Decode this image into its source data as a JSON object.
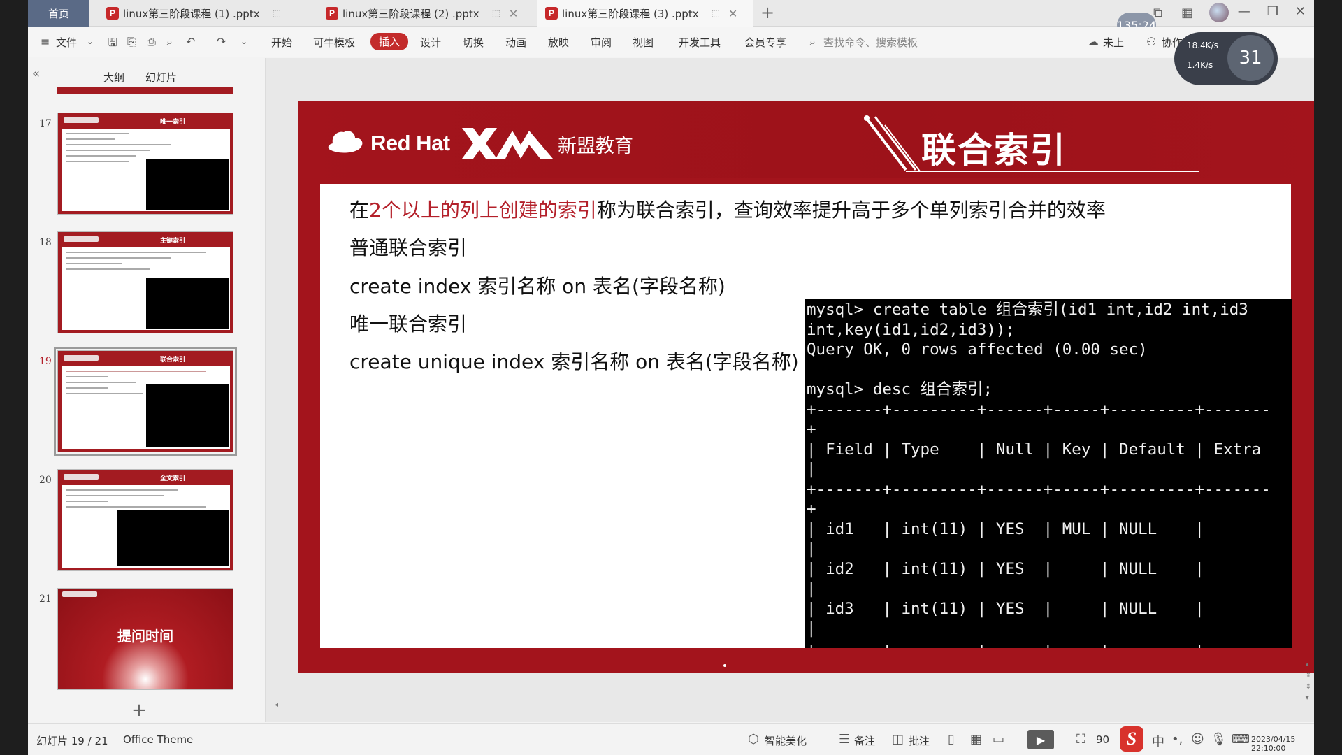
{
  "titlebar": {
    "home_tab": "首页",
    "tabs": [
      {
        "label": "linux第三阶段课程 (1) .pptx"
      },
      {
        "label": "linux第三阶段课程 (2) .pptx"
      },
      {
        "label": "linux第三阶段课程 (3) .pptx"
      }
    ],
    "timer": "135:24"
  },
  "ribbon": {
    "file": "文件",
    "menus": [
      "开始",
      "可牛模板",
      "插入",
      "设计",
      "切换",
      "动画",
      "放映",
      "审阅",
      "视图",
      "开发工具",
      "会员专享"
    ],
    "active_menu": "插入",
    "search_placeholder": "查找命令、搜索模板",
    "cloud": "未上",
    "collab": "协作"
  },
  "net_widget": {
    "up": "18.4K/s",
    "down": "1.4K/s",
    "value": "31"
  },
  "left_panel": {
    "tabs": [
      "大纲",
      "幻灯片"
    ],
    "slides": [
      {
        "num": "17",
        "title": "唯一索引"
      },
      {
        "num": "18",
        "title": "主键索引"
      },
      {
        "num": "19",
        "title": "联合索引"
      },
      {
        "num": "20",
        "title": "全文索引"
      },
      {
        "num": "21",
        "title": "提问时间"
      }
    ]
  },
  "slide": {
    "brand_redhat": "Red Hat",
    "brand_xm": "新盟教育",
    "title": "联合索引",
    "line1_pre": "在",
    "line1_hl": "2个以上的列上创建的索引",
    "line1_post": "称为联合索引，查询效率提升高于多个单列索引合并的效率",
    "line2": "普通联合索引",
    "line3": "create index 索引名称 on 表名(字段名称)",
    "line4": "唯一联合索引",
    "line5": "create unique index 索引名称 on 表名(字段名称)",
    "terminal": "mysql> create table 组合索引(id1 int,id2 int,id3\nint,key(id1,id2,id3));\nQuery OK, 0 rows affected (0.00 sec)\n\nmysql> desc 组合索引;\n+-------+---------+------+-----+---------+-------\n+\n| Field | Type    | Null | Key | Default | Extra\n|\n+-------+---------+------+-----+---------+-------\n+\n| id1   | int(11) | YES  | MUL | NULL    |\n|\n| id2   | int(11) | YES  |     | NULL    |\n|\n| id3   | int(11) | YES  |     | NULL    |\n|\n+-------+---------+------+-----+---------+-------"
  },
  "statusbar": {
    "slide_counter": "幻灯片 19 / 21",
    "theme": "Office Theme",
    "beautify": "智能美化",
    "notes": "备注",
    "comments": "批注",
    "zoom": "90",
    "datetime": "2023/04/15 22:10:00"
  },
  "colors": {
    "accent": "#c32b2b",
    "slide_red": "#a3141c",
    "highlight": "#b4202a"
  }
}
